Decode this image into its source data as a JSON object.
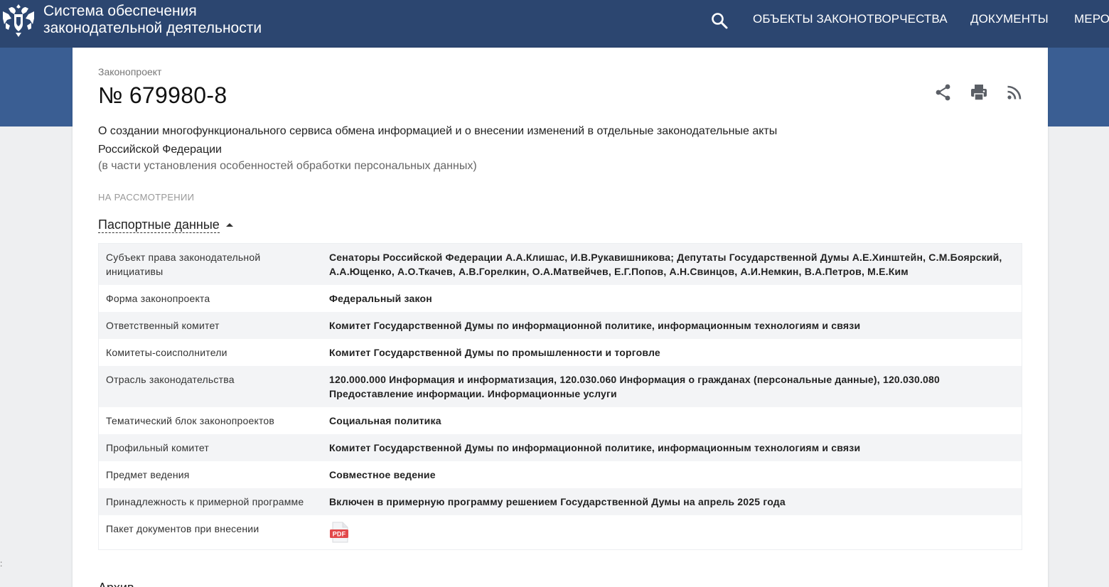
{
  "header": {
    "title_line1": "Система обеспечения",
    "title_line2": "законодательной деятельности",
    "search_icon": "search-icon",
    "nav": [
      "ОБЪЕКТЫ ЗАКОНОТВОРЧЕСТВА",
      "ДОКУМЕНТЫ",
      "МЕРО"
    ]
  },
  "bill": {
    "kind": "Законопроект",
    "number": "№ 679980-8",
    "title": "О создании многофункционального сервиса обмена информацией и о внесении изменений в отдельные законодательные акты Российской Федерации",
    "subtitle": "(в части установления особенностей обработки персональных данных)",
    "status": "НА РАССМОТРЕНИИ"
  },
  "actions": [
    "share-icon",
    "print-icon",
    "rss-icon"
  ],
  "passport": {
    "section_label": "Паспортные данные",
    "rows": [
      {
        "key": "Субъект права законодательной инициативы",
        "value": "Сенаторы Российской Федерации А.А.Клишас, И.В.Рукавишникова; Депутаты Государственной Думы А.Е.Хинштейн, С.М.Боярский, А.А.Ющенко, А.О.Ткачев, А.В.Горелкин, О.А.Матвейчев, Е.Г.Попов, А.Н.Свинцов, А.И.Немкин, В.А.Петров, М.Е.Ким"
      },
      {
        "key": "Форма законопроекта",
        "value": "Федеральный закон"
      },
      {
        "key": "Ответственный комитет",
        "value": "Комитет Государственной Думы по информационной политике, информационным технологиям и связи"
      },
      {
        "key": "Комитеты-соисполнители",
        "value": "Комитет Государственной Думы по промышленности и торговле"
      },
      {
        "key": "Отрасль законодательства",
        "value": "120.000.000 Информация и информатизация, 120.030.060 Информация о гражданах (персональные данные), 120.030.080 Предоставление информации. Информационные услуги"
      },
      {
        "key": "Тематический блок законопроектов",
        "value": "Социальная политика"
      },
      {
        "key": "Профильный комитет",
        "value": "Комитет Государственной Думы по информационной политике, информационным технологиям и связи"
      },
      {
        "key": "Предмет ведения",
        "value": "Совместное ведение"
      },
      {
        "key": "Принадлежность к примерной программе",
        "value": "Включен в примерную программу решением Государственной Думы на апрель 2025 года"
      },
      {
        "key": "Пакет документов при внесении",
        "pdf_label": "PDF"
      }
    ]
  },
  "archive_label": "Архив",
  "colors": {
    "header_bg": "#2c4670",
    "band_bg": "#3a5e93",
    "pdf_red": "#e2494b"
  }
}
